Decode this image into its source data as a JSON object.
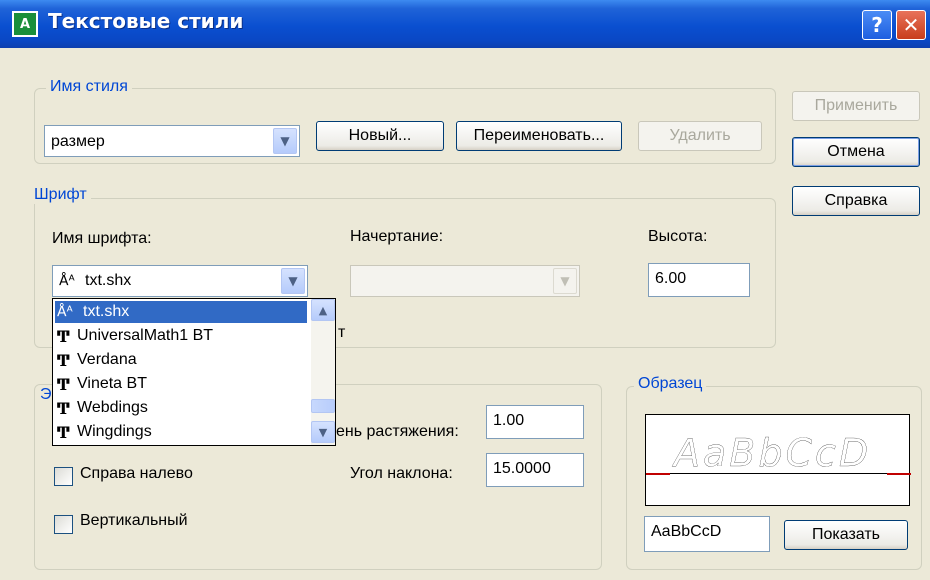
{
  "window": {
    "title": "Текстовые стили",
    "help_label": "?",
    "close_label": "✕",
    "icon_label": "A"
  },
  "style_name": {
    "legend": "Имя стиля",
    "selected": "размер",
    "new_button": "Новый...",
    "rename_button": "Переименовать...",
    "delete_button": "Удалить"
  },
  "side_buttons": {
    "apply": "Применить",
    "cancel": "Отмена",
    "help": "Справка"
  },
  "font": {
    "legend": "Шрифт",
    "font_name_label": "Имя шрифта:",
    "font_name_value": "txt.shx",
    "style_label": "Начертание:",
    "style_value": "",
    "height_label": "Высота:",
    "height_value": "6.00",
    "partial_label": "т",
    "dropdown_items": [
      {
        "label": "txt.shx",
        "icon": "shx-font-icon",
        "selected": true
      },
      {
        "label": "UniversalMath1 BT",
        "icon": "truetype-font-icon",
        "selected": false
      },
      {
        "label": "Verdana",
        "icon": "truetype-font-icon",
        "selected": false
      },
      {
        "label": "Vineta BT",
        "icon": "truetype-font-icon",
        "selected": false
      },
      {
        "label": "Webdings",
        "icon": "truetype-font-icon",
        "selected": false
      },
      {
        "label": "Wingdings",
        "icon": "truetype-font-icon",
        "selected": false
      }
    ]
  },
  "effects": {
    "legend_partial": "Э",
    "width_factor_label": "ень растяжения:",
    "width_factor_value": "1.00",
    "oblique_label": "Угол наклона:",
    "oblique_value": "15.0000",
    "right_to_left_label": "Справа налево",
    "vertical_label": "Вертикальный"
  },
  "preview": {
    "legend": "Образец",
    "sample_text": "AaBbCcD",
    "preview_display": "AaBbCcD",
    "show_button": "Показать"
  },
  "colors": {
    "title_bar": "#0a4fd0",
    "selection": "#316ac5",
    "legend_text": "#0046d5",
    "baseline": "#c00000"
  }
}
